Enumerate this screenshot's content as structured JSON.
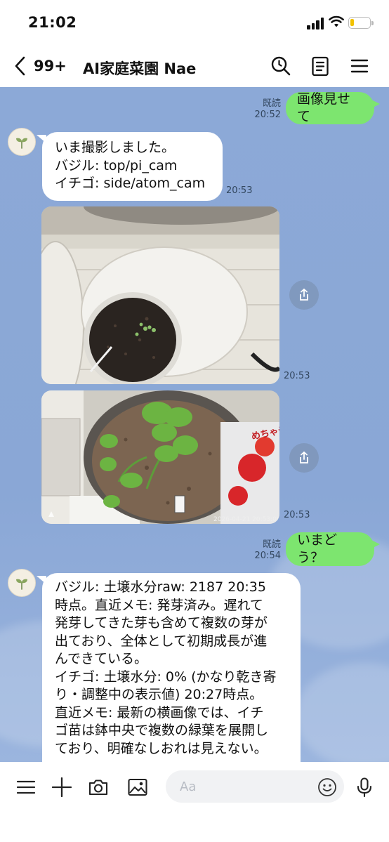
{
  "status_bar": {
    "time": "21:02"
  },
  "header": {
    "back_count": "99+",
    "title": "AI家庭菜園 Nae"
  },
  "messages": {
    "m1": {
      "text": "画像見せて",
      "read": "既読",
      "time": "20:52"
    },
    "m2": {
      "lines": [
        "いま撮影しました。",
        "バジル: top/pi_cam",
        "イチゴ: side/atom_cam"
      ],
      "time": "20:53"
    },
    "m3": {
      "time": "20:53"
    },
    "m4": {
      "time": "20:53",
      "camera_stamp": "2026-04-21 20:53:00",
      "bag_label": "めちゃデカいちご"
    },
    "m5": {
      "text": "いまどう？",
      "read": "既読",
      "time": "20:54"
    },
    "m6": {
      "lines": [
        "バジル: 土壌水分raw: 2187 20:35",
        "時点。直近メモ: 発芽済み。遅れて",
        "発芽してきた芽も含めて複数の芽が",
        "出ており、全体として初期成長が進",
        "んできている。",
        "イチゴ: 土壌水分: 0% (かなり乾き寄",
        "り・調整中の表示値) 20:27時点。",
        "直近メモ: 最新の横画像では、イチ",
        "ゴ苗は鉢中央で複数の緑葉を展開し",
        "ており、明確なしおれは見えない。"
      ]
    }
  },
  "input": {
    "placeholder": "Aa"
  },
  "icons": {
    "back": "chevron-left-icon",
    "search": "search-icon",
    "notes": "notes-icon",
    "menu": "hamburger-menu-icon",
    "share": "share-icon",
    "avatar": "sprout-icon",
    "bottom": [
      "list-icon",
      "plus-icon",
      "camera-icon",
      "image-icon",
      "emoji-icon",
      "microphone-icon"
    ]
  },
  "colors": {
    "chat_background": "#8ca9d7",
    "my_bubble": "#7de56f",
    "bot_bubble": "#ffffff",
    "battery": "#f2c200"
  }
}
